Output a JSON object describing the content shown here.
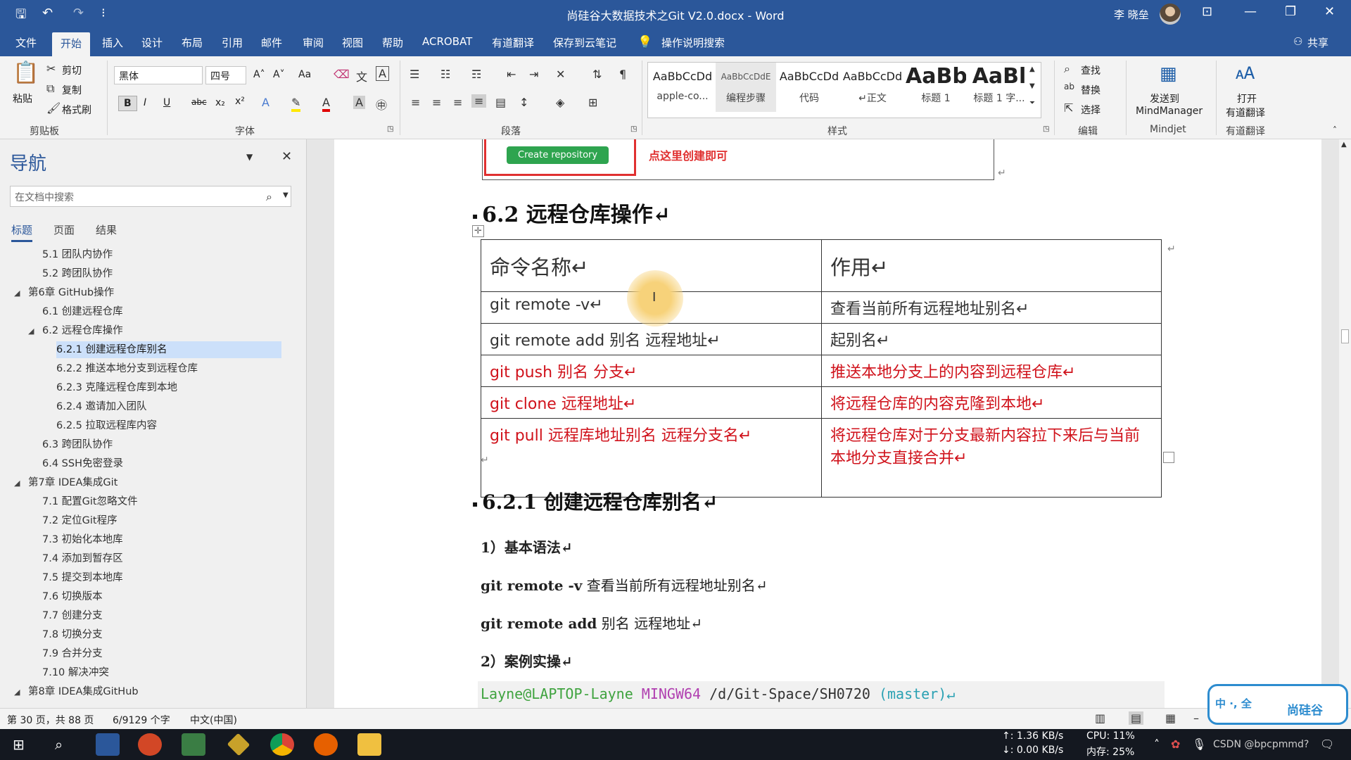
{
  "titlebar": {
    "document_title": "尚硅谷大数据技术之Git V2.0.docx  -  Word",
    "user_name": "李 晓垒",
    "qa_save": "🖫",
    "qa_undo": "↶",
    "qa_redo": "↷",
    "qa_more": "⁝",
    "ribbon_display": "⊡",
    "minimize": "—",
    "restore": "❐",
    "close": "✕"
  },
  "menu": {
    "tabs": [
      "文件",
      "开始",
      "插入",
      "设计",
      "布局",
      "引用",
      "邮件",
      "审阅",
      "视图",
      "帮助",
      "ACROBAT",
      "有道翻译",
      "保存到云笔记"
    ],
    "tell_me": "操作说明搜索",
    "share": "共享"
  },
  "ribbon": {
    "clipboard": {
      "paste": "粘贴",
      "cut": "剪切",
      "copy": "复制",
      "format_painter": "格式刷",
      "label": "剪贴板"
    },
    "font": {
      "name": "黑体",
      "size": "四号",
      "label": "字体",
      "bold": "B",
      "italic": "I",
      "underline": "U",
      "strike": "abc",
      "sub": "x₂",
      "sup": "x²",
      "grow": "A˄",
      "shrink": "A˅",
      "case": "Aa"
    },
    "paragraph": {
      "label": "段落"
    },
    "styles": {
      "label": "样式",
      "items": [
        {
          "sample": "AaBbCcDd",
          "name": "apple-co..."
        },
        {
          "sample": "AaBbCcDdE",
          "name": "编程步骤"
        },
        {
          "sample": "AaBbCcDd",
          "name": "代码"
        },
        {
          "sample": "AaBbCcDd",
          "name": "↵正文"
        },
        {
          "sample": "AaBb",
          "name": "标题 1"
        },
        {
          "sample": "AaBl",
          "name": "标题 1 字..."
        }
      ]
    },
    "editing": {
      "find": "查找",
      "replace": "替换",
      "select": "选择",
      "label": "编辑"
    },
    "mindjet": {
      "send_line1": "发送到",
      "send_line2": "MindManager",
      "label": "Mindjet"
    },
    "youdao": {
      "open_line1": "打开",
      "open_line2": "有道翻译",
      "label": "有道翻译"
    }
  },
  "nav": {
    "title": "导航",
    "search_placeholder": "在文档中搜索",
    "tabs": [
      "标题",
      "页面",
      "结果"
    ],
    "items": [
      {
        "text": "5.1 团队内协作",
        "level": 2
      },
      {
        "text": "5.2 跨团队协作",
        "level": 2
      },
      {
        "text": "第6章 GitHub操作",
        "level": 1
      },
      {
        "text": "6.1 创建远程仓库",
        "level": 2
      },
      {
        "text": "6.2 远程仓库操作",
        "level": 2
      },
      {
        "text": "6.2.1 创建远程仓库别名",
        "level": 3
      },
      {
        "text": "6.2.2 推送本地分支到远程仓库",
        "level": 3
      },
      {
        "text": "6.2.3 克隆远程仓库到本地",
        "level": 3
      },
      {
        "text": "6.2.4 邀请加入团队",
        "level": 3
      },
      {
        "text": "6.2.5 拉取远程库内容",
        "level": 3
      },
      {
        "text": "6.3 跨团队协作",
        "level": 2
      },
      {
        "text": "6.4 SSH免密登录",
        "level": 2
      },
      {
        "text": "第7章 IDEA集成Git",
        "level": 1
      },
      {
        "text": "7.1 配置Git忽略文件",
        "level": 2
      },
      {
        "text": "7.2 定位Git程序",
        "level": 2
      },
      {
        "text": "7.3 初始化本地库",
        "level": 2
      },
      {
        "text": "7.4 添加到暂存区",
        "level": 2
      },
      {
        "text": "7.5 提交到本地库",
        "level": 2
      },
      {
        "text": "7.6 切换版本",
        "level": 2
      },
      {
        "text": "7.7 创建分支",
        "level": 2
      },
      {
        "text": "7.8 切换分支",
        "level": 2
      },
      {
        "text": "7.9 合并分支",
        "level": 2
      },
      {
        "text": "7.10 解决冲突",
        "level": 2
      },
      {
        "text": "第8章 IDEA集成GitHub",
        "level": 1
      }
    ],
    "selected_index": 5
  },
  "doc": {
    "create_repo_button": "Create repository",
    "create_repo_note": "点这里创建即可",
    "heading_62": "6.2  远程仓库操作↵",
    "table": {
      "headers": [
        "命令名称↵",
        "作用↵"
      ],
      "rows": [
        {
          "cmd": "git remote -v↵",
          "desc": "查看当前所有远程地址别名↵",
          "red": false
        },
        {
          "cmd": "git remote add  别名  远程地址↵",
          "desc": "起别名↵",
          "red": false
        },
        {
          "cmd": "git push  别名  分支↵",
          "desc": "推送本地分支上的内容到远程仓库↵",
          "red": true
        },
        {
          "cmd": "git clone  远程地址↵",
          "desc": "将远程仓库的内容克隆到本地↵",
          "red": true
        },
        {
          "cmd": "git pull  远程库地址别名  远程分支名↵",
          "desc": "将远程仓库对于分支最新内容拉下来后与当前本地分支直接合并↵",
          "red": true
        }
      ]
    },
    "heading_621": "6.2.1  创建远程仓库别名↵",
    "sub1": "1）基本语法↵",
    "syntax1_cmd": "git remote -v",
    "syntax1_desc": "  查看当前所有远程地址别名↵",
    "syntax2_cmd": "git remote add",
    "syntax2_desc": "  别名  远程地址↵",
    "sub2": "2）案例实操↵",
    "terminal": {
      "user": "Layne@LAPTOP-Layne",
      "env": "MINGW64",
      "path": "/d/Git-Space/SH0720",
      "branch": "(master)↵"
    }
  },
  "status": {
    "page": "第 30 页，共 88 页",
    "words": "6/9129 个字",
    "language": "中文(中国)"
  },
  "taskbar": {
    "net_up": "↑: 1.36 KB/s",
    "net_down": "↓: 0.00 KB/s",
    "cpu": "CPU: 11%",
    "mem": "内存: 25%",
    "tray_text": "CSDN @bpcpmmd?",
    "logo_text": "尚硅谷",
    "ime_text": "中 ·, 全"
  },
  "colors": {
    "brand_blue": "#2b579a",
    "doc_red": "#d0121b",
    "github_green": "#2ea44f",
    "term_green": "#3fa33f",
    "term_purple": "#b03fb0",
    "term_cyan": "#2aa1b3"
  }
}
